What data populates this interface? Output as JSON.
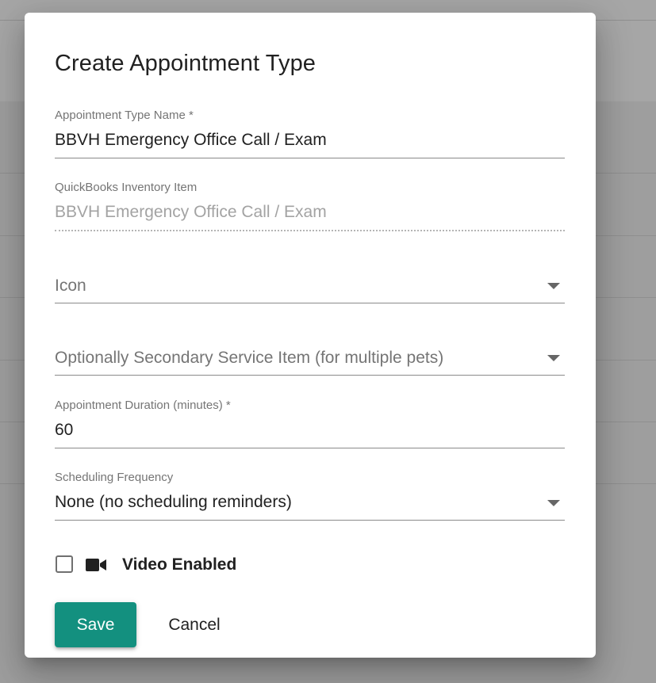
{
  "dialog": {
    "title": "Create Appointment Type"
  },
  "fields": {
    "appointment_type_name": {
      "label": "Appointment Type Name *",
      "value": "BBVH Emergency Office Call / Exam"
    },
    "quickbooks_inventory_item": {
      "label": "QuickBooks Inventory Item",
      "value": "BBVH Emergency Office Call / Exam"
    },
    "icon": {
      "placeholder": "Icon"
    },
    "secondary_service_item": {
      "placeholder": "Optionally Secondary Service Item (for multiple pets)"
    },
    "appointment_duration": {
      "label": "Appointment Duration (minutes) *",
      "value": "60"
    },
    "scheduling_frequency": {
      "label": "Scheduling Frequency",
      "value": "None (no scheduling reminders)"
    }
  },
  "video": {
    "label": "Video Enabled",
    "checked": false,
    "icon": "video-camera-icon"
  },
  "buttons": {
    "save": "Save",
    "cancel": "Cancel"
  },
  "colors": {
    "primary": "#13907f",
    "backdrop": "#9e9e9e"
  }
}
